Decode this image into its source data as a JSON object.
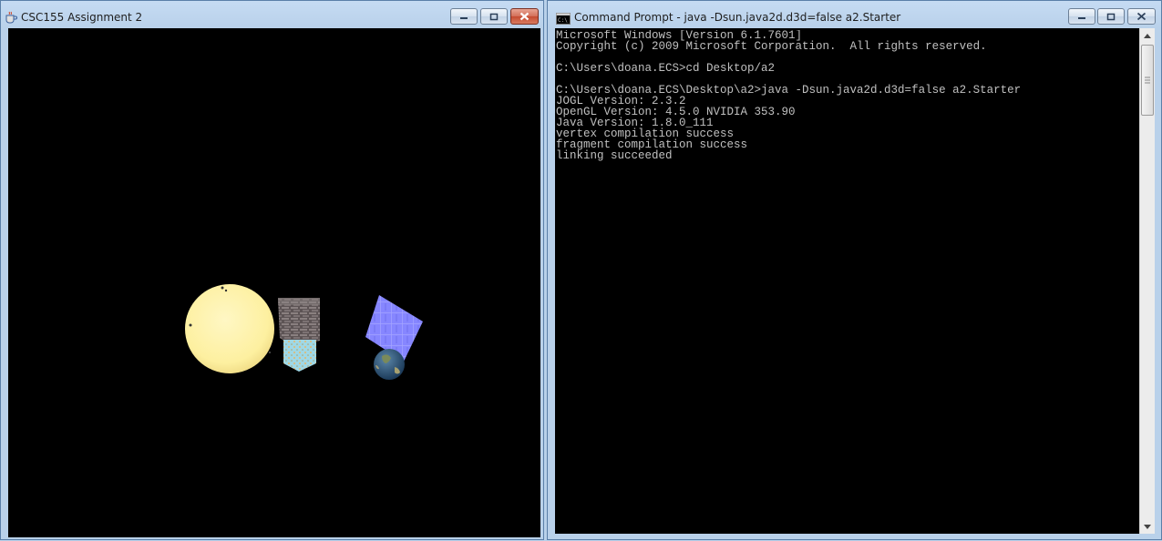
{
  "java_window": {
    "title": "CSC155 Assignment 2",
    "scene_objects": [
      "sun",
      "brick-cube",
      "textured-pyramid",
      "textured-plane",
      "earth"
    ]
  },
  "cmd_window": {
    "title": "Command Prompt - java  -Dsun.java2d.d3d=false a2.Starter",
    "icon": "cmd-icon",
    "lines": [
      "Microsoft Windows [Version 6.1.7601]",
      "Copyright (c) 2009 Microsoft Corporation.  All rights reserved.",
      "",
      "C:\\Users\\doana.ECS>cd Desktop/a2",
      "",
      "C:\\Users\\doana.ECS\\Desktop\\a2>java -Dsun.java2d.d3d=false a2.Starter",
      "JOGL Version: 2.3.2",
      "OpenGL Version: 4.5.0 NVIDIA 353.90",
      "Java Version: 1.8.0_111",
      "vertex compilation success",
      "fragment compilation success",
      "linking succeeded"
    ]
  },
  "colors": {
    "desktop": "#b9d1ea",
    "console_text": "#c0c0c0",
    "sun": "#fdf1a6",
    "plane": "#8c8cff"
  }
}
